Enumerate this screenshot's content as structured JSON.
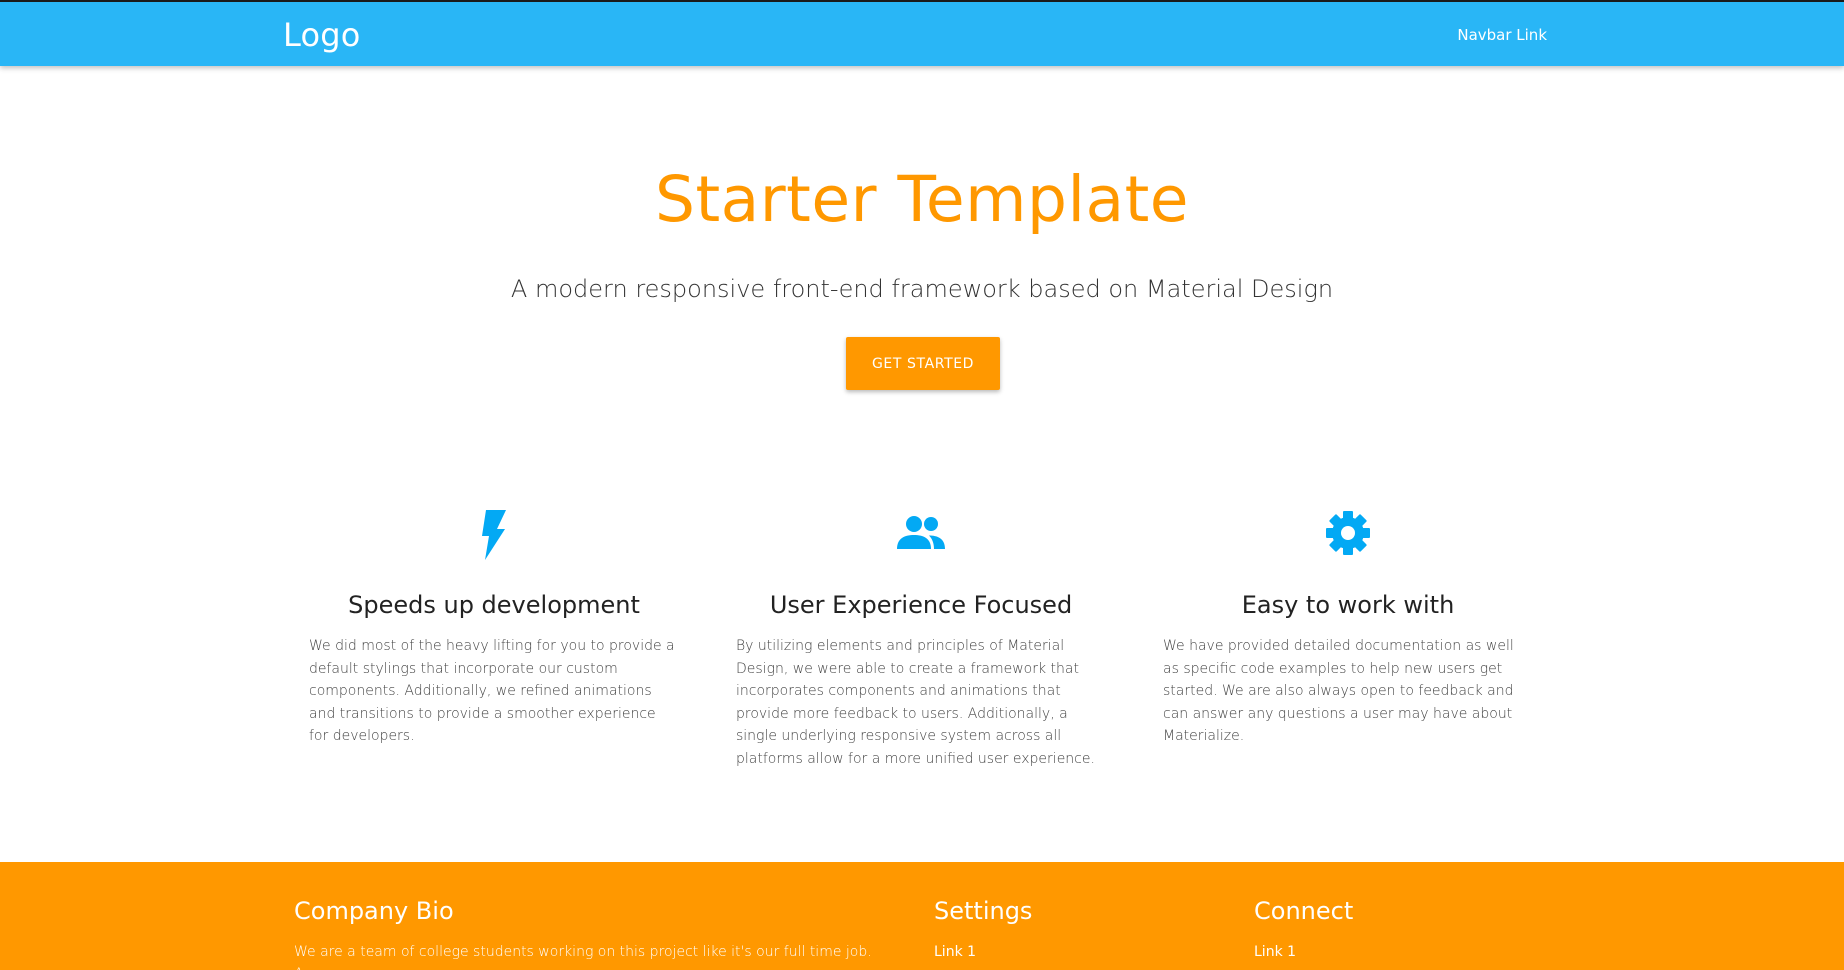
{
  "navbar": {
    "logo": "Logo",
    "link": "Navbar Link",
    "background": "#29b6f6"
  },
  "hero": {
    "title": "Starter Template",
    "subtitle": "A modern responsive front-end framework based on Material Design",
    "cta_label": "Get Started",
    "accent": "#ff9800"
  },
  "features": [
    {
      "icon": "flash-icon",
      "title": "Speeds up development",
      "text": "We did most of the heavy lifting for you to provide a default stylings that incorporate our custom components. Additionally, we refined animations and transitions to provide a smoother experience for developers."
    },
    {
      "icon": "group-icon",
      "title": "User Experience Focused",
      "text": "By utilizing elements and principles of Material Design, we were able to create a framework that incorporates components and animations that provide more feedback to users. Additionally, a single underlying responsive system across all platforms allow for a more unified user experience."
    },
    {
      "icon": "settings-icon",
      "title": "Easy to work with",
      "text": "We have provided detailed documentation as well as specific code examples to help new users get started. We are also always open to feedback and can answer any questions a user may have about Materialize."
    }
  ],
  "footer": {
    "background": "#ff9800",
    "bio_heading": "Company Bio",
    "bio_text": "We are a team of college students working on this project like it's our full time job. Any",
    "settings_heading": "Settings",
    "settings_links": [
      "Link 1"
    ],
    "connect_heading": "Connect",
    "connect_links": [
      "Link 1"
    ]
  }
}
